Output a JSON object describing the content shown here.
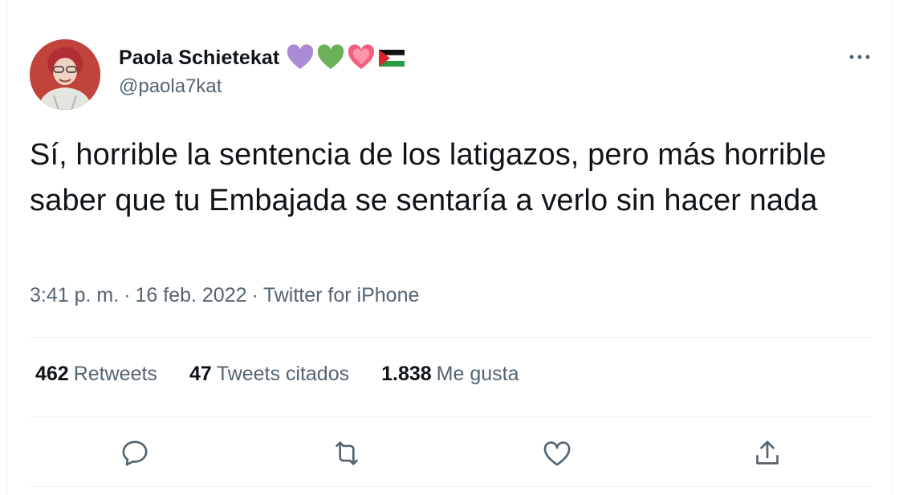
{
  "tweet": {
    "author": {
      "display_name": "Paola Schietekat",
      "handle": "@paola7kat",
      "name_emojis": [
        "purple-heart",
        "green-heart",
        "growing-heart",
        "palestine-flag"
      ]
    },
    "text": "Sí, horrible la sentencia de los latigazos, pero más horrible saber que tu Embajada se sentaría a verlo sin hacer nada",
    "time": "3:41 p. m.",
    "date": "16 feb. 2022",
    "source": "Twitter for iPhone",
    "separator": "·",
    "stats": {
      "retweets_count": "462",
      "retweets_label": "Retweets",
      "quotes_count": "47",
      "quotes_label": "Tweets citados",
      "likes_count": "1.838",
      "likes_label": "Me gusta"
    },
    "actions": [
      "reply-icon",
      "retweet-icon",
      "like-icon",
      "share-icon"
    ],
    "colors": {
      "text": "#0f1419",
      "secondary": "#536471",
      "divider": "#eff3f4"
    }
  }
}
